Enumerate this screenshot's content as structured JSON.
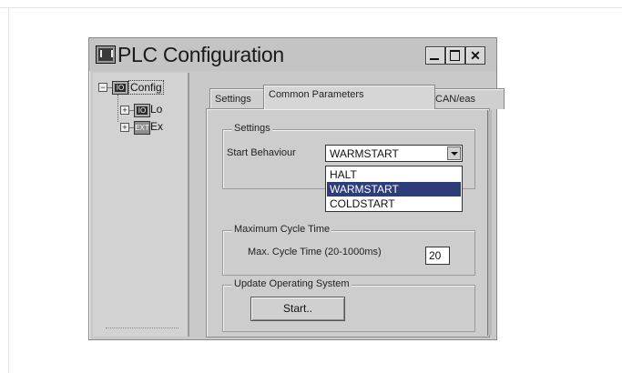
{
  "window": {
    "title": "PLC Configuration",
    "controls": {
      "minimize": "_",
      "maximize": "□",
      "close": "✕"
    }
  },
  "tree": {
    "root": {
      "label": "Config",
      "expander": "−",
      "icon": "IO"
    },
    "children": [
      {
        "label": "Lo",
        "expander": "+",
        "icon": "IO"
      },
      {
        "label": "Ex",
        "expander": "+",
        "icon": "EXT"
      }
    ]
  },
  "tabs": [
    "Settings",
    "Common Parameters",
    "CAN/eas"
  ],
  "active_tab": "Common Parameters",
  "settings_group": {
    "legend": "Settings",
    "start_behaviour_label": "Start Behaviour",
    "selected": "WARMSTART",
    "options": [
      "HALT",
      "WARMSTART",
      "COLDSTART"
    ],
    "highlighted_option": "WARMSTART"
  },
  "cycle_group": {
    "legend": "Maximum Cycle Time",
    "label": "Max. Cycle Time (20-1000ms)",
    "value": "20"
  },
  "update_group": {
    "legend": "Update Operating System",
    "button": "Start.."
  }
}
